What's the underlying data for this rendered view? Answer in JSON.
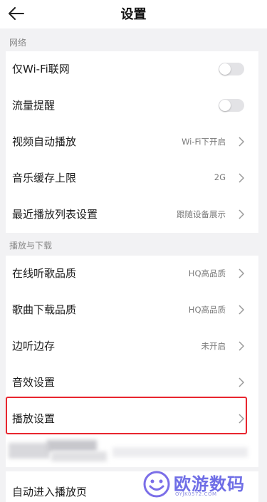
{
  "header": {
    "title": "设置"
  },
  "network": {
    "section_label": "网络",
    "rows": [
      {
        "label": "仅Wi-Fi联网",
        "toggle_on": false
      },
      {
        "label": "流量提醒",
        "toggle_on": false
      },
      {
        "label": "视频自动播放",
        "value": "Wi-Fi下开启"
      },
      {
        "label": "音乐缓存上限",
        "value": "2G"
      },
      {
        "label": "最近播放列表设置",
        "value": "跟随设备展示"
      }
    ]
  },
  "playback_download": {
    "section_label": "播放与下载",
    "rows": [
      {
        "label": "在线听歌品质",
        "value": "HQ高品质"
      },
      {
        "label": "歌曲下载品质",
        "value": "HQ高品质"
      },
      {
        "label": "边听边存",
        "value": "未开启"
      },
      {
        "label": "音效设置"
      },
      {
        "label": "播放设置"
      }
    ]
  },
  "partial_row": {
    "label": "自动进入播放页"
  },
  "watermark": {
    "text": "欧游数码",
    "subtext": "OYJK0572.COM"
  },
  "colors": {
    "background": "#f2f2f4",
    "card": "#ffffff",
    "highlight": "#e8262f",
    "secondary_text": "#7a7a7a",
    "watermark": "#6f6ee6"
  },
  "icons": {
    "back": "arrow-left-icon",
    "chevron": "chevron-right-icon",
    "watermark_logo": "smiley-logo-icon"
  }
}
